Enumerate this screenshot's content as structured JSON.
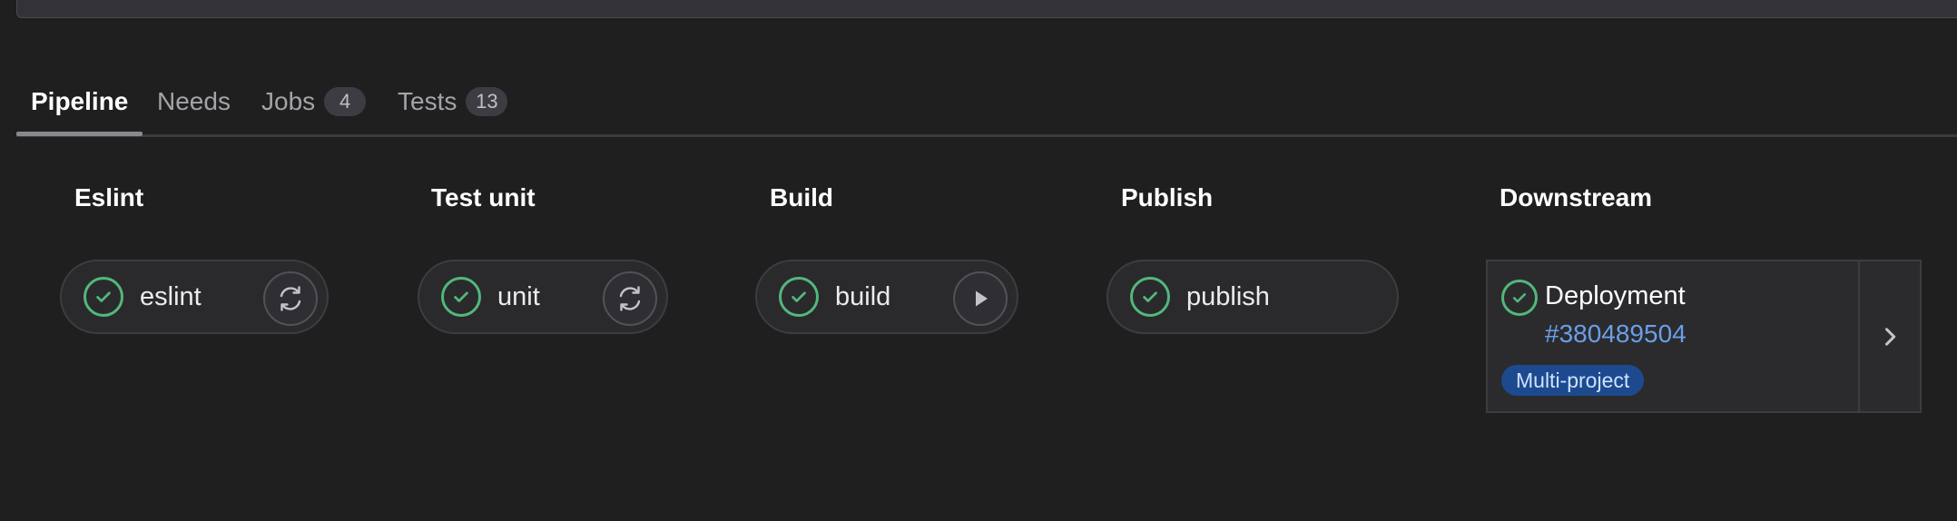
{
  "tabs": [
    {
      "label": "Pipeline",
      "count": null
    },
    {
      "label": "Needs",
      "count": null
    },
    {
      "label": "Jobs",
      "count": "4"
    },
    {
      "label": "Tests",
      "count": "13"
    }
  ],
  "stages": [
    {
      "title": "Eslint",
      "job": "eslint",
      "action": "retry-icon"
    },
    {
      "title": "Test unit",
      "job": "unit",
      "action": "retry-icon"
    },
    {
      "title": "Build",
      "job": "build",
      "action": "play-icon"
    },
    {
      "title": "Publish",
      "job": "publish",
      "action": null
    },
    {
      "title": "Downstream"
    }
  ],
  "downstream": {
    "name": "Deployment",
    "pipeline_id": "#380489504",
    "badge": "Multi-project"
  },
  "colors": {
    "success": "#52b87a",
    "link": "#6a9fe8",
    "badge_bg": "#1d4a8f"
  }
}
